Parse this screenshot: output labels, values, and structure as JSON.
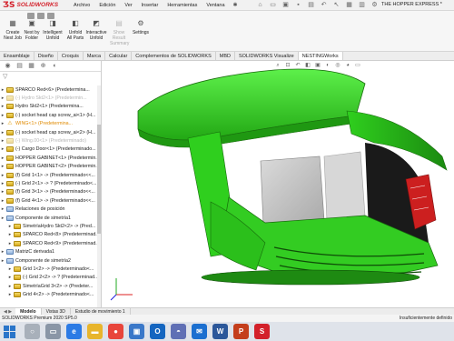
{
  "app": {
    "logo_mark": "ƷS",
    "logo_text": "SOLIDWORKS",
    "document_title": "THE HOPPER EXPRESS *"
  },
  "menu": [
    "Archivo",
    "Edición",
    "Ver",
    "Insertar",
    "Herramientas",
    "Ventana"
  ],
  "ribbon": {
    "buttons": [
      {
        "label1": "Create",
        "label2": "Nest Job",
        "icon": "create-nest-job-icon"
      },
      {
        "label1": "Nest by",
        "label2": "Folder",
        "icon": "nest-by-folder-icon"
      },
      {
        "label1": "Intelligent",
        "label2": "Unfold",
        "icon": "intelligent-unfold-icon"
      },
      {
        "label1": "Unfold",
        "label2": "All Parts",
        "icon": "unfold-all-parts-icon"
      },
      {
        "label1": "Interactive",
        "label2": "Unfold",
        "icon": "interactive-unfold-icon"
      },
      {
        "label1": "Show",
        "label2": "Result",
        "label3": "Summary",
        "icon": "show-result-icon"
      },
      {
        "label1": "Settings",
        "label2": "",
        "icon": "settings-icon"
      }
    ]
  },
  "tabs": [
    "Ensamblaje",
    "Diseño",
    "Croquis",
    "Marca",
    "Calcular",
    "Complementos de SOLIDWORKS",
    "MBD",
    "SOLIDWORKS Visualize",
    "NESTINGWorks"
  ],
  "active_tab": "NESTINGWorks",
  "tree": [
    {
      "label": "SPARCO Red<6> (Predetermina...",
      "state": "normal",
      "icon": "part"
    },
    {
      "label": "(-) Hydro Skt2<1> (Predetermin...",
      "state": "dimmed",
      "icon": "part"
    },
    {
      "label": "Hydro Skt2<1> (Predetermina...",
      "state": "normal",
      "icon": "part"
    },
    {
      "label": "(-) socket head cap screw_ai<1> (H...",
      "state": "normal",
      "icon": "part"
    },
    {
      "label": "WING<1> (Predetermina...",
      "state": "warned",
      "icon": "warn"
    },
    {
      "label": "(-) socket head cap screw_ai<2> (H...",
      "state": "normal",
      "icon": "part"
    },
    {
      "label": "(-) Wing.00<1> (Predeterminado)",
      "state": "dimmed",
      "icon": "part"
    },
    {
      "label": "(-) Cargo Door<1> (Predeterminado...",
      "state": "normal",
      "icon": "part"
    },
    {
      "label": "HOPPER GABINET<1> (Predetermin...",
      "state": "normal",
      "icon": "part"
    },
    {
      "label": "HOPPER GABINET<2> (Predetermin...",
      "state": "normal",
      "icon": "part"
    },
    {
      "label": "(f) Grid 1<1> -> (Predeterminado<<...",
      "state": "normal",
      "icon": "part"
    },
    {
      "label": "(-) Grid 2<1> -> ? (Predeterminado<...",
      "state": "normal",
      "icon": "part"
    },
    {
      "label": "(f) Grid 3<1> -> (Predeterminado<<...",
      "state": "normal",
      "icon": "part"
    },
    {
      "label": "(f) Grid 4<1> -> (Predeterminado<<...",
      "state": "normal",
      "icon": "part"
    },
    {
      "label": "Relaciones de posición",
      "state": "normal",
      "icon": "folder"
    },
    {
      "label": "Componente de simetría1",
      "state": "normal",
      "icon": "folder"
    },
    {
      "label": "SimetríaHydro Skt2<2> -> (Pred...",
      "state": "normal",
      "icon": "part"
    },
    {
      "label": "SPARCO Red<8> (Predeterminad...",
      "state": "normal",
      "icon": "part"
    },
    {
      "label": "SPARCO Red<9> (Predeterminad...",
      "state": "normal",
      "icon": "part"
    },
    {
      "label": "MatrizC derivada1",
      "state": "normal",
      "icon": "folder"
    },
    {
      "label": "Componente de simetría2",
      "state": "normal",
      "icon": "folder"
    },
    {
      "label": "Grid 1<2> -> (Predeterminado<...",
      "state": "normal",
      "icon": "part"
    },
    {
      "label": "(-) Grid 2<2> -> ? (Predeterminad...",
      "state": "normal",
      "icon": "part"
    },
    {
      "label": "SimetríaGrid 3<2> -> (Predeter...",
      "state": "normal",
      "icon": "part"
    },
    {
      "label": "Grid 4<2> -> (Predeterminado<...",
      "state": "normal",
      "icon": "part"
    }
  ],
  "bottom_tabs": [
    "Modelo",
    "Vistas 3D",
    "Estudio de movimiento 1"
  ],
  "active_bottom_tab": "Modelo",
  "status": {
    "left": "SOLIDWORKS Premium 2020 SP5.0",
    "right": "Insuficientemente definido"
  },
  "colors": {
    "body_green": "#33cc22",
    "accent_red": "#d3202a",
    "seat_red": "#cc1f1f"
  },
  "taskbar": [
    "windows-start-icon",
    "search-icon",
    "task-view-icon",
    "edge-icon",
    "file-explorer-icon",
    "chrome-icon",
    "store-icon",
    "outlook-icon",
    "photos-icon",
    "mail-icon",
    "word-icon",
    "powerpoint-icon",
    "solidworks-icon"
  ]
}
